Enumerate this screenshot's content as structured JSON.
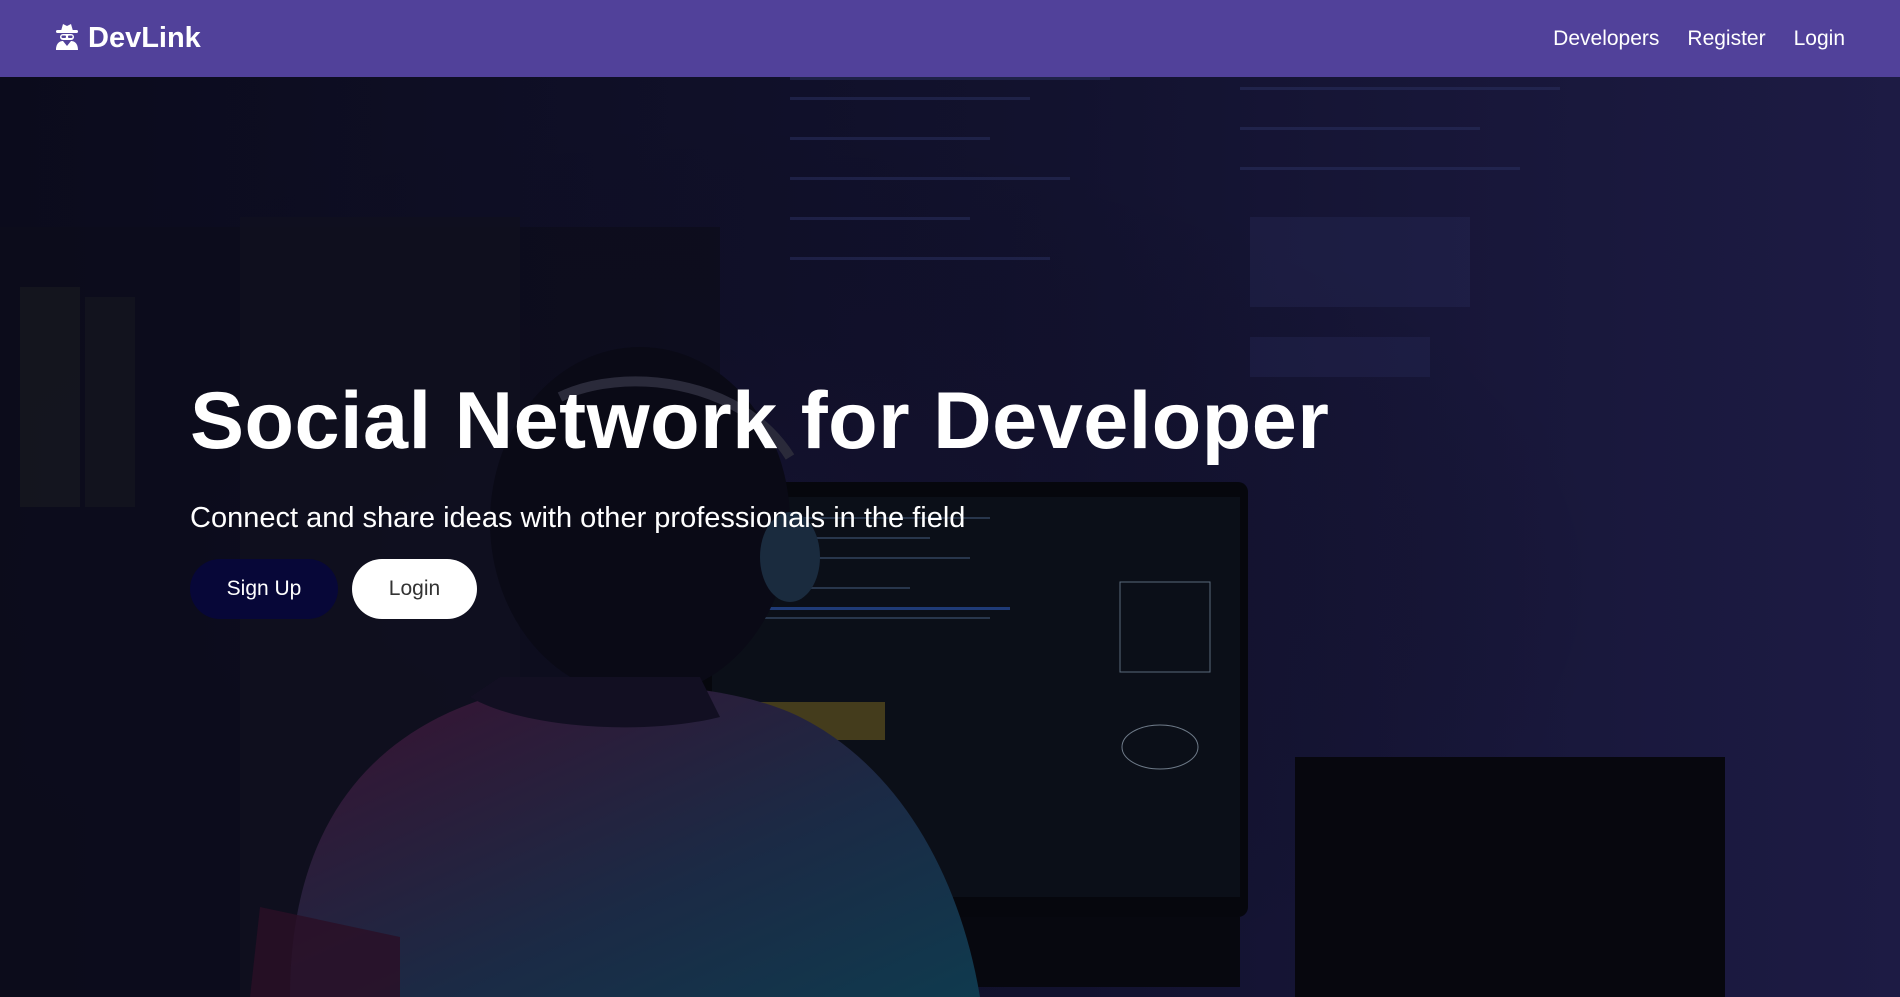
{
  "brand": {
    "label": "DevLink",
    "icon": "user-secret-icon"
  },
  "nav": {
    "links": [
      "Developers",
      "Register",
      "Login"
    ]
  },
  "hero": {
    "title": "Social Network for Developer",
    "subtitle": "Connect and share ideas with other professionals in the field",
    "signup_label": "Sign Up",
    "login_label": "Login"
  },
  "colors": {
    "navbar": "#51419a",
    "signup_button": "#070738",
    "login_button": "#ffffff"
  }
}
